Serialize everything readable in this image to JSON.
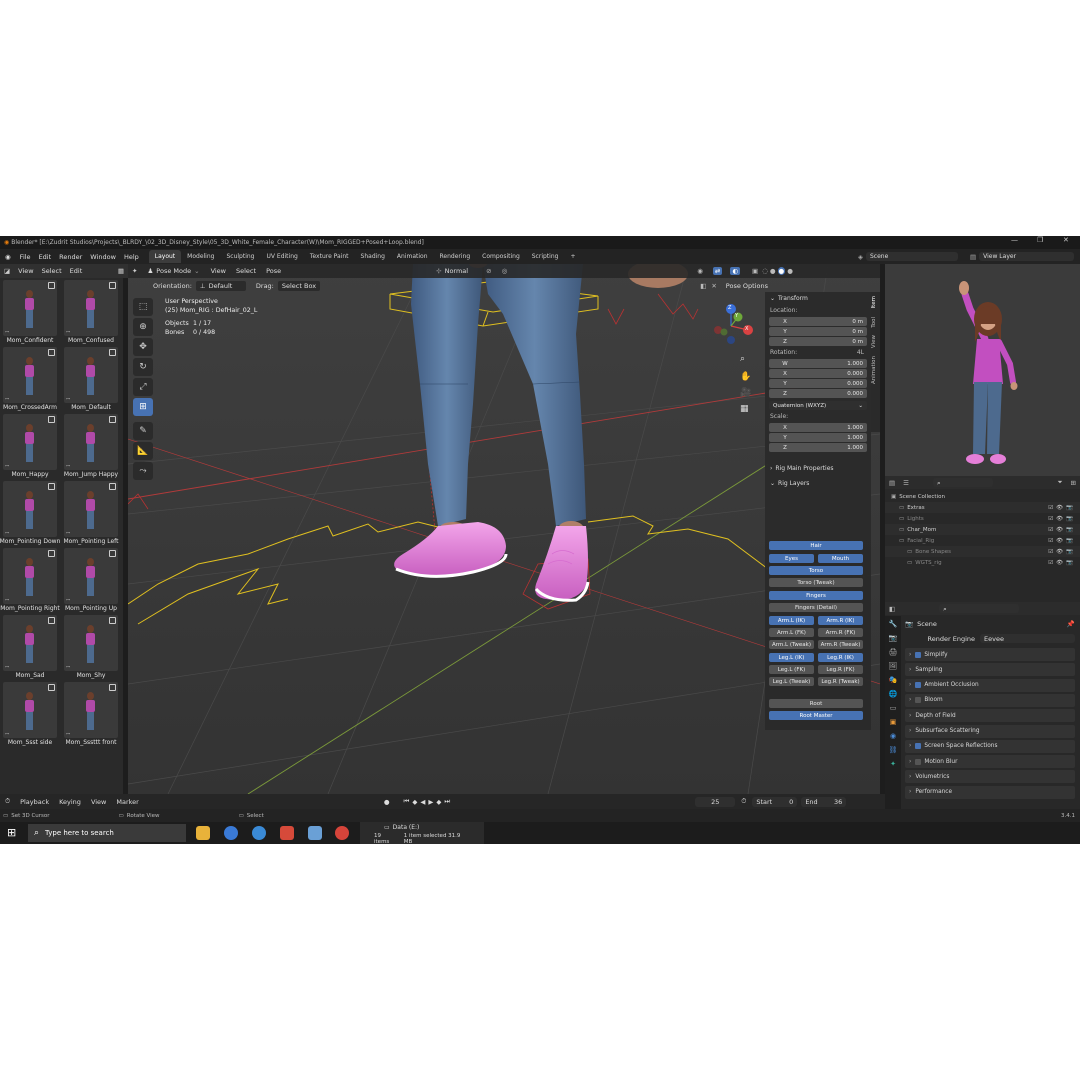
{
  "window": {
    "title": "Blender* [E:\\Zudrit Studios\\Projects\\_BLRDY_\\02_3D_Disney_Style\\05_3D_White_Female_Character(W)\\Mom_RIGGED+Posed+Loop.blend]",
    "controls": [
      "—",
      "❐",
      "✕"
    ]
  },
  "menu": {
    "items": [
      "File",
      "Edit",
      "Render",
      "Window",
      "Help"
    ],
    "workspaces": [
      "Layout",
      "Modeling",
      "Sculpting",
      "UV Editing",
      "Texture Paint",
      "Shading",
      "Animation",
      "Rendering",
      "Compositing",
      "Scripting"
    ],
    "active_workspace": "Layout",
    "add_tab": "+",
    "scene_label": "Scene",
    "view_layer_label": "View Layer"
  },
  "asset_browser": {
    "menu": [
      "View",
      "Select",
      "Edit"
    ],
    "items": [
      "Mom_Confident",
      "Mom_Confused",
      "Mom_CrossedArm",
      "Mom_Default",
      "Mom_Happy",
      "Mom_Jump Happy",
      "Mom_Pointing Down",
      "Mom_Pointing Left",
      "Mom_Pointing Right",
      "Mom_Pointing Up",
      "Mom_Sad",
      "Mom_Shy",
      "Mom_Ssst side",
      "Mom_Sssttt front"
    ]
  },
  "viewport": {
    "mode": "Pose Mode",
    "menu": [
      "View",
      "Select",
      "Pose"
    ],
    "orientation_label": "Orientation:",
    "orientation": "Default",
    "drag_label": "Drag:",
    "drag": "Select Box",
    "transform_pivot": "Normal",
    "pose_options": "Pose Options",
    "info": {
      "view": "User Perspective",
      "object": "(25) Mom_RIG : DefHair_02_L",
      "objects_label": "Objects",
      "objects_value": "1 / 17",
      "bones_label": "Bones",
      "bones_value": "0 / 498"
    },
    "gizmo": {
      "x": "X",
      "y": "Y",
      "z": "Z"
    }
  },
  "npanel": {
    "tabs": [
      "Item",
      "Tool",
      "View",
      "Animation"
    ],
    "transform_header": "Transform",
    "location_label": "Location:",
    "location": [
      {
        "k": "X",
        "v": "0 m"
      },
      {
        "k": "Y",
        "v": "0 m"
      },
      {
        "k": "Z",
        "v": "0 m"
      }
    ],
    "rotation_label": "Rotation:",
    "rotation_mode_short": "4L",
    "rotation": [
      {
        "k": "W",
        "v": "1.000"
      },
      {
        "k": "X",
        "v": "0.000"
      },
      {
        "k": "Y",
        "v": "0.000"
      },
      {
        "k": "Z",
        "v": "0.000"
      }
    ],
    "rotation_mode": "Quaternion (WXYZ)",
    "scale_label": "Scale:",
    "scale": [
      {
        "k": "X",
        "v": "1.000"
      },
      {
        "k": "Y",
        "v": "1.000"
      },
      {
        "k": "Z",
        "v": "1.000"
      }
    ],
    "rig_main": "Rig Main Properties",
    "rig_layers": "Rig Layers",
    "layers": {
      "hair": "Hair",
      "eyes": "Eyes",
      "mouth": "Mouth",
      "torso": "Torso",
      "torso_tweak": "Torso (Tweak)",
      "fingers": "Fingers",
      "fingers_detail": "Fingers (Detail)",
      "arm_l_ik": "Arm.L (IK)",
      "arm_r_ik": "Arm.R (IK)",
      "arm_l_fk": "Arm.L (FK)",
      "arm_r_fk": "Arm.R (FK)",
      "arm_l_tweak": "Arm.L (Tweak)",
      "arm_r_tweak": "Arm.R (Tweak)",
      "leg_l_ik": "Leg.L (IK)",
      "leg_r_ik": "Leg.R (IK)",
      "leg_l_fk": "Leg.L (FK)",
      "leg_r_fk": "Leg.R (FK)",
      "leg_l_tweak": "Leg.L (Tweak)",
      "leg_r_tweak": "Leg.R (Tweak)",
      "root": "Root",
      "root_master": "Root Master"
    }
  },
  "outliner": {
    "rows": [
      {
        "label": "Scene Collection"
      },
      {
        "label": "Extras"
      },
      {
        "label": "Lights"
      },
      {
        "label": "Char_Mom"
      },
      {
        "label": "Facial_Rig"
      },
      {
        "label": "Bone Shapes"
      },
      {
        "label": "WGTS_rig"
      }
    ]
  },
  "properties": {
    "scene": "Scene",
    "render_engine_label": "Render Engine",
    "render_engine": "Eevee",
    "sections": [
      {
        "label": "Simplify",
        "checked": true
      },
      {
        "label": "Sampling"
      },
      {
        "label": "Ambient Occlusion",
        "checked": true
      },
      {
        "label": "Bloom",
        "checked": false
      },
      {
        "label": "Depth of Field"
      },
      {
        "label": "Subsurface Scattering"
      },
      {
        "label": "Screen Space Reflections",
        "checked": true
      },
      {
        "label": "Motion Blur",
        "checked": false
      },
      {
        "label": "Volumetrics"
      },
      {
        "label": "Performance"
      }
    ]
  },
  "timeline": {
    "menu": [
      "Playback",
      "Keying",
      "View",
      "Marker"
    ],
    "current_frame": "25",
    "start_label": "Start",
    "start": "0",
    "end_label": "End",
    "end": "36"
  },
  "status": {
    "set_cursor": "Set 3D Cursor",
    "rotate_view": "Rotate View",
    "select": "Select",
    "version": "3.4.1"
  },
  "taskbar": {
    "search_placeholder": "Type here to search",
    "explorer_path": "Data (E:)",
    "items_count": "19 items",
    "selected": "1 item selected  31.9 MB"
  },
  "colors": {
    "accent": "#4772b3",
    "armature_yellow": "#e0c020",
    "pink_shoe": "#e57fd8",
    "jeans": "#50709a",
    "shirt": "#c24fc0"
  }
}
